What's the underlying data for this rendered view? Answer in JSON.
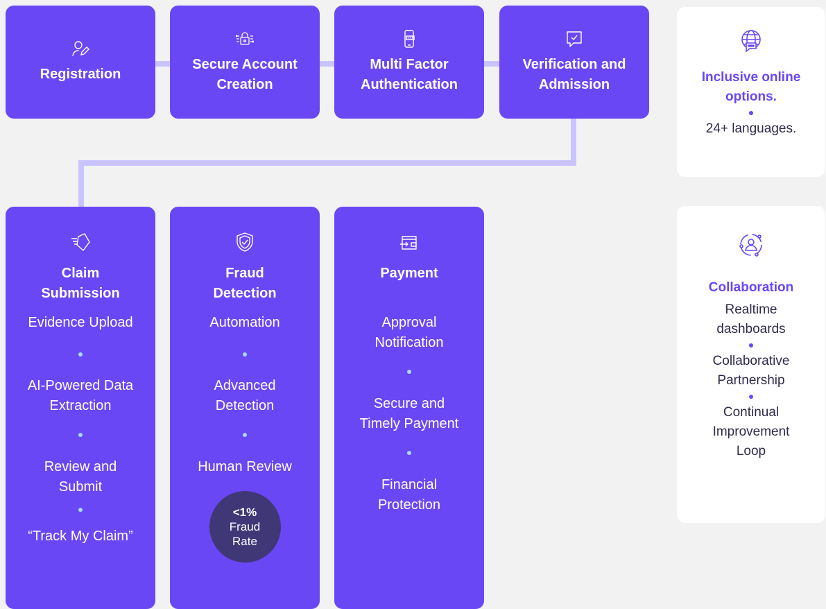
{
  "colors": {
    "card": "#6a47f5",
    "connector": "#c9c4ff",
    "dot": "#a9d8ff",
    "badge": "#3f3776",
    "side_bg": "#ffffff",
    "side_accent": "#6a47f5"
  },
  "top_steps": [
    {
      "title_line1": "Registration",
      "title_line2": "",
      "icon": "user-edit-icon"
    },
    {
      "title_line1": "Secure Account",
      "title_line2": "Creation",
      "icon": "circuit-lock-icon"
    },
    {
      "title_line1": "Multi Factor",
      "title_line2": "Authentication",
      "icon": "phone-password-icon"
    },
    {
      "title_line1": "Verification and",
      "title_line2": "Admission",
      "icon": "chat-check-icon"
    }
  ],
  "claim": {
    "title_line1": "Claim",
    "title_line2": "Submission",
    "icon": "tag-arrow-icon",
    "items": [
      [
        "Evidence Upload"
      ],
      [
        "AI-Powered Data",
        "Extraction"
      ],
      [
        "Review and",
        "Submit"
      ],
      [
        "“Track My Claim”"
      ]
    ]
  },
  "fraud": {
    "title_line1": "Fraud",
    "title_line2": "Detection",
    "icon": "shield-check-icon",
    "items": [
      [
        "Automation"
      ],
      [
        "Advanced",
        "Detection"
      ],
      [
        "Human Review"
      ]
    ],
    "badge": {
      "value": "<1%",
      "label_line1": "Fraud",
      "label_line2": "Rate"
    }
  },
  "payment": {
    "title_line1": "Payment",
    "title_line2": "",
    "icon": "wallet-arrow-icon",
    "items": [
      [
        "Approval",
        "Notification"
      ],
      [
        "Secure and",
        "Timely Payment"
      ],
      [
        "Financial",
        "Protection"
      ]
    ]
  },
  "inclusive": {
    "title_line1": "Inclusive online",
    "title_line2": "options.",
    "item": "24+ languages.",
    "icon": "globe-chat-icon"
  },
  "collaboration": {
    "title": "Collaboration",
    "icon": "user-cycle-icon",
    "items": [
      [
        "Realtime",
        "dashboards"
      ],
      [
        "Collaborative",
        "Partnership"
      ],
      [
        "Continual",
        "Improvement",
        "Loop"
      ]
    ]
  }
}
